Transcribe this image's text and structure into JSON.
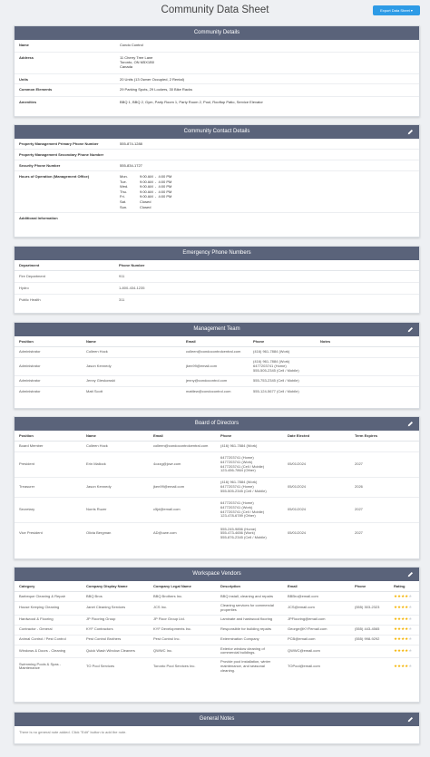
{
  "header": {
    "title": "Community Data Sheet",
    "export_label": "Export Data Sheet ▾"
  },
  "community_details": {
    "title": "Community Details",
    "rows": [
      {
        "label": "Name",
        "value": "Condo Control"
      },
      {
        "label": "Address",
        "value": "11 Cherry Tree Lane\nToronto, ON M5X1B0\nCanada"
      },
      {
        "label": "Units",
        "value": "20 Units (13 Owner Occupied, 2 Rental)"
      },
      {
        "label": "Common Elements",
        "value": "29 Parking Spots, 29 Lockers, 30 Bike Racks"
      },
      {
        "label": "Amenities",
        "value": "BBQ 1, BBQ 2, Gym, Party Room 1, Party Room 2, Pool, Rooftop Patio, Service Elevator"
      }
    ]
  },
  "contact_details": {
    "title": "Community Contact Details",
    "primary_label": "Property Management Primary Phone Number",
    "primary_value": "555-874-1288",
    "secondary_label": "Property Management Secondary Phone Number",
    "secondary_value": "",
    "security_label": "Security Phone Number",
    "security_value": "555-834-1727",
    "hours_label": "Hours of Operation (Management Office)",
    "hours": [
      {
        "day": "Mon.",
        "time": "9:00 AM  -  4:00 PM"
      },
      {
        "day": "Tue.",
        "time": "9:00 AM  -  4:00 PM"
      },
      {
        "day": "Wed.",
        "time": "9:00 AM  -  4:00 PM"
      },
      {
        "day": "Thu.",
        "time": "9:00 AM  -  4:00 PM"
      },
      {
        "day": "Fri.",
        "time": "9:00 AM  -  4:00 PM"
      },
      {
        "day": "Sat.",
        "time": "Closed"
      },
      {
        "day": "Sun.",
        "time": "Closed"
      }
    ],
    "additional_label": "Additional Information",
    "additional_value": ""
  },
  "emergency": {
    "title": "Emergency Phone Numbers",
    "columns": [
      "Department",
      "Phone Number"
    ],
    "rows": [
      [
        "Fire Department",
        "911"
      ],
      [
        "Hydro",
        "1-800-434-1235"
      ],
      [
        "Public Health",
        "311"
      ]
    ]
  },
  "management": {
    "title": "Management Team",
    "columns": [
      "Position",
      "Name",
      "Email",
      "Phone",
      "Notes"
    ],
    "rows": [
      [
        "Administrator",
        "Colleen Hock",
        "colleen@condocontrolcentral.com",
        "(416) 961-7884 (Work)",
        ""
      ],
      [
        "Administrator",
        "Jason Kennedy",
        "jken99@email.com",
        "(416) 961-7884 (Work)\n6477203741 (Home)\n555-505-2345 (Cell / Mobile)",
        ""
      ],
      [
        "Administrator",
        "Jenny Gieskowski",
        "jenny@condocontrol.com",
        "555-753-2345 (Cell / Mobile)",
        ""
      ],
      [
        "Administrator",
        "Matt Scott",
        "mattlew@condocontrol.com",
        "555-124-5677 (Cell / Mobile)",
        ""
      ]
    ]
  },
  "board": {
    "title": "Board of Directors",
    "columns": [
      "Position",
      "Name",
      "Email",
      "Phone",
      "Date Elected",
      "Term Expires"
    ],
    "rows": [
      [
        "Board Member",
        "Colleen Hock",
        "colleen@condocontrolcentral.com",
        "(416) 961-7884 (Work)",
        "",
        ""
      ],
      [
        "President",
        "Erin Mallock",
        "4ozzg@jcwr.com",
        "6477203741 (Home)\n6477203741 (Work)\n6477203741 (Cell / Mobile)\n123-456-7864 (Other)",
        "05/01/2024",
        "2027"
      ],
      [
        "Treasurer",
        "Jason Kennedy",
        "jken99@email.com",
        "(416) 961-7884 (Work)\n6477203741 (Home)\n555-505-2345 (Cell / Mobile)",
        "05/01/2024",
        "2026"
      ],
      [
        "Secretary",
        "Norris Ruzer",
        "c5jd@email.com",
        "6477203741 (Home)\n6477203741 (Work)\n6477203741 (Cell / Mobile)\n123-478-6789 (Other)",
        "05/01/2024",
        "2027"
      ],
      [
        "Vice President",
        "Olivia Bergman",
        "AD@uwe.com",
        "555-245-9856 (Home)\n555-473-4656 (Work)\n555-876-2345 (Cell / Mobile)",
        "05/01/2024",
        "2027"
      ]
    ]
  },
  "vendors": {
    "title": "Workspace Vendors",
    "columns": [
      "Category",
      "Company Display Name",
      "Company Legal Name",
      "Description",
      "Email",
      "Phone",
      "Rating"
    ],
    "rows": [
      {
        "cells": [
          "Barbeque Cleaning & Repair",
          "BBQ Bros",
          "BBQ Brothers Inc.",
          "BBQ install, cleaning and repairs",
          "BBBro@email.com",
          ""
        ],
        "rating": 4
      },
      {
        "cells": [
          "House Keeping Cleaning",
          "Janet Cleaning Services",
          "JCS Inc.",
          "Cleaning services for commercial properties",
          "JCS@email.com",
          "(555) 303-2323"
        ],
        "rating": 4
      },
      {
        "cells": [
          "Hardwood & Flooring",
          "JP Flooring Group",
          "JP Floor Group Ltd.",
          "Laminate and hardwood flooring",
          "JPFlooring@email.com",
          ""
        ],
        "rating": 4
      },
      {
        "cells": [
          "Contractor - General",
          "KYF Contractors",
          "KYF Developments Inc.",
          "Responsible for building repairs",
          "George@KYFemail.com",
          "(555) 443-4565"
        ],
        "rating": 4
      },
      {
        "cells": [
          "Animal Control / Pest Control",
          "Pest Control Brothers",
          "Pest Control Inc.",
          "Extermination Company",
          "PCB@email.com",
          "(555) 998-9292"
        ],
        "rating": 4
      },
      {
        "cells": [
          "Windows & Doors - Cleaning",
          "Quick Wash Window Cleaners",
          "QWWC Inc.",
          "Exterior window cleaning of commercial buildings.",
          "QWWC@email.com",
          ""
        ],
        "rating": 4
      },
      {
        "cells": [
          "Swimming Pools & Spas - Maintenance",
          "TO Pool Services",
          "Toronto Pool Services Inc.",
          "Provide pool installation, winter maintenance, and seasonal cleaning.",
          "TOPool@email.com",
          ""
        ],
        "rating": 4
      }
    ]
  },
  "general_notes": {
    "title": "General Notes",
    "empty_text": "There is no general note added. Click \"Edit\" button to add the note."
  },
  "icons": {
    "edit": "pencil-icon"
  },
  "colors": {
    "header_bar": "#5a637a",
    "export_button": "#2d9be6",
    "star": "#f5b301"
  }
}
